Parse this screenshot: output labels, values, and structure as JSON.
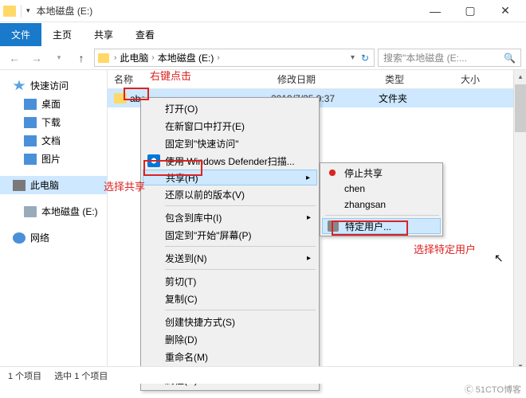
{
  "window": {
    "title": "本地磁盘 (E:)",
    "min": "—",
    "max": "▢",
    "close": "✕"
  },
  "tabs": {
    "file": "文件",
    "home": "主页",
    "share": "共享",
    "view": "查看"
  },
  "address": {
    "crumb1": "此电脑",
    "crumb2": "本地磁盘 (E:)",
    "search_placeholder": "搜索\"本地磁盘 (E:...",
    "refresh": "↻"
  },
  "nav": {
    "quick": "快速访问",
    "desktop": "桌面",
    "downloads": "下载",
    "documents": "文档",
    "pictures": "图片",
    "thispc": "此电脑",
    "drive_e": "本地磁盘 (E:)",
    "network": "网络"
  },
  "columns": {
    "name": "名称",
    "date": "修改日期",
    "type": "类型",
    "size": "大小"
  },
  "row": {
    "name": "abc",
    "date": "2019/7/25 9:37",
    "type": "文件夹"
  },
  "ctx": {
    "open": "打开(O)",
    "open_new": "在新窗口中打开(E)",
    "pin_quick": "固定到\"快速访问\"",
    "defender": "使用 Windows Defender扫描...",
    "share": "共享(H)",
    "restore": "还原以前的版本(V)",
    "include": "包含到库中(I)",
    "pin_start": "固定到\"开始\"屏幕(P)",
    "sendto": "发送到(N)",
    "cut": "剪切(T)",
    "copy": "复制(C)",
    "shortcut": "创建快捷方式(S)",
    "delete": "删除(D)",
    "rename": "重命名(M)",
    "properties": "属性(R)"
  },
  "submenu": {
    "stop": "停止共享",
    "u1": "chen",
    "u2": "zhangsan",
    "specific": "特定用户..."
  },
  "annotations": {
    "a1": "右键点击",
    "a2": "选择共享",
    "a3": "选择特定用户"
  },
  "status": {
    "count": "1 个项目",
    "selected": "选中 1 个项目"
  },
  "watermark": "Ⓒ 51CTO博客"
}
